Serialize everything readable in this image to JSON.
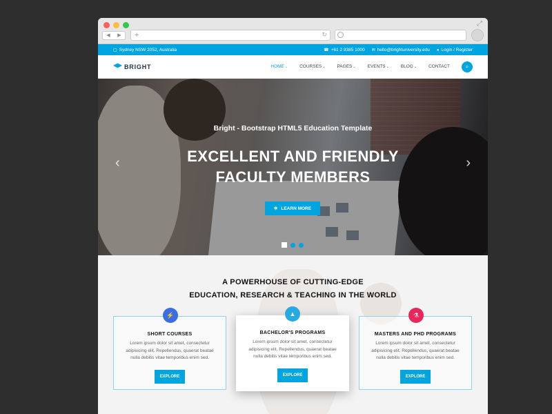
{
  "browser": {
    "back": "◀",
    "forward": "▶",
    "new_tab": "+",
    "reload": "↻",
    "expand": "⤢"
  },
  "topbar": {
    "location": "Sydney NSW 2052, Australia",
    "phone": "+61 2 9385 1000",
    "email": "hello@brightuniversity.edu",
    "login": "Login / Register"
  },
  "header": {
    "logo": "BRIGHT",
    "nav": [
      {
        "label": "HOME",
        "caret": true
      },
      {
        "label": "COURSES",
        "caret": true
      },
      {
        "label": "PAGES",
        "caret": true
      },
      {
        "label": "EVENTS",
        "caret": true
      },
      {
        "label": "BLOG",
        "caret": true
      },
      {
        "label": "CONTACT",
        "caret": false
      }
    ]
  },
  "hero": {
    "subtitle": "Bright - Bootstrap HTML5 Education Template",
    "title_line1": "EXCELLENT AND FRIENDLY",
    "title_line2": "FACULTY MEMBERS",
    "button": "LEARN MORE",
    "prev": "‹",
    "next": "›"
  },
  "section": {
    "heading_line1": "A POWERHOUSE OF CUTTING-EDGE",
    "heading_line2": "EDUCATION, RESEARCH & TEACHING IN THE WORLD",
    "cards": [
      {
        "title": "SHORT COURSES",
        "desc": "Lorem ipsum dolor sit amet, consectetur adipisicing elit. Repellendus, quaerat beatae nulla debitis vitae temporibus enim sed.",
        "button": "EXPLORE",
        "icon_color": "#3a6fe3"
      },
      {
        "title": "BACHELOR'S PROGRAMS",
        "desc": "Lorem ipsum dolor sit amet, consectetur adipisicing elit. Repellendus, quaerat beatae nulla debitis vitae temporibus enim sed.",
        "button": "EXPLORE",
        "icon_color": "#27aae1"
      },
      {
        "title": "MASTERS AND PHD PROGRAMS",
        "desc": "Lorem ipsum dolor sit amet, consectetur adipisicing elit. Repellendus, quaerat beatae nulla debitis vitae temporibus enim sed.",
        "button": "EXPLORE",
        "icon_color": "#e8265c"
      }
    ]
  },
  "colors": {
    "accent": "#00a5df",
    "dark": "#22324a"
  }
}
